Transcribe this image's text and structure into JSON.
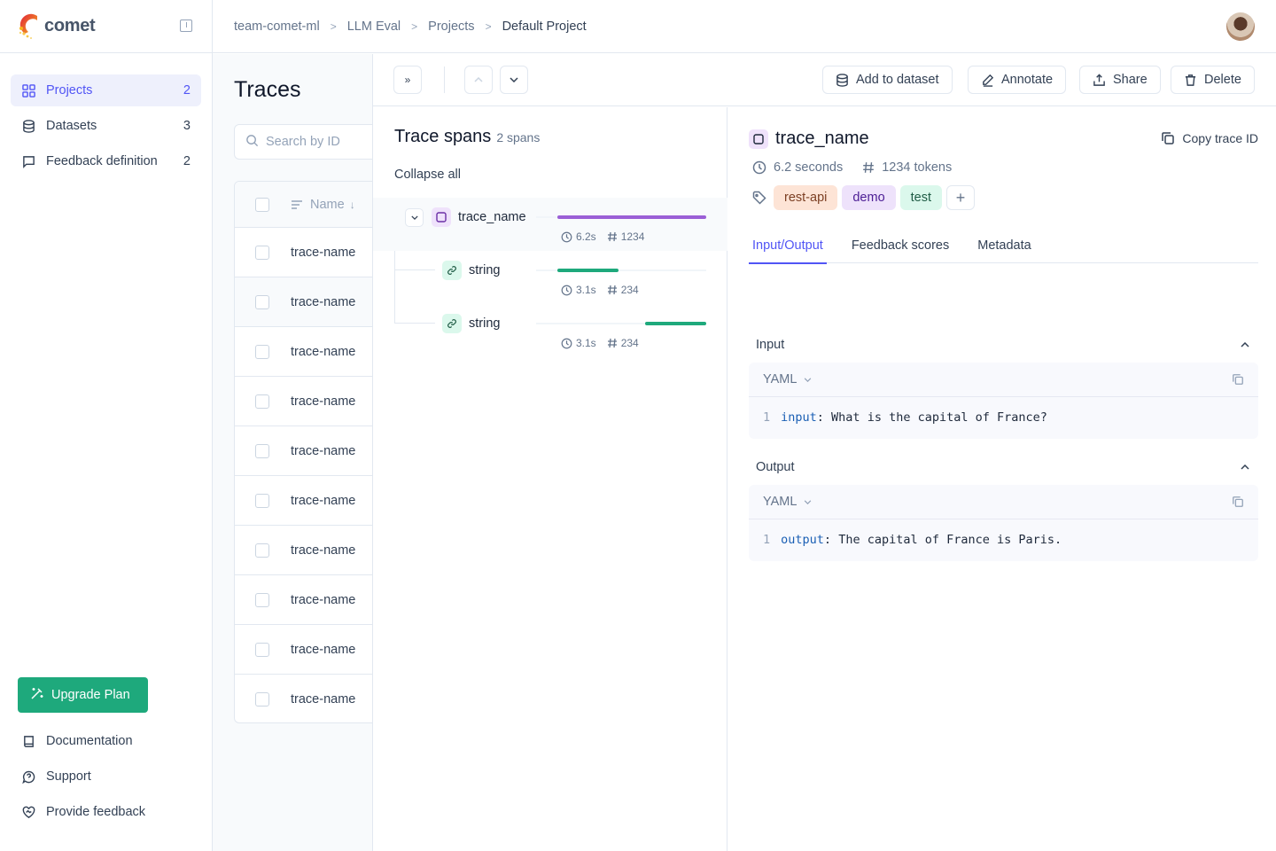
{
  "app": {
    "logo_text": "comet"
  },
  "sidebar": {
    "items": [
      {
        "label": "Projects",
        "count": "2",
        "icon": "grid-icon",
        "active": true
      },
      {
        "label": "Datasets",
        "count": "3",
        "icon": "database-icon"
      },
      {
        "label": "Feedback definition",
        "count": "2",
        "icon": "message-square-icon"
      }
    ],
    "upgrade_label": "Upgrade Plan",
    "bottom_items": [
      {
        "label": "Documentation",
        "icon": "book-icon"
      },
      {
        "label": "Support",
        "icon": "help-bubble-icon"
      },
      {
        "label": "Provide feedback",
        "icon": "heart-handshake-icon"
      }
    ]
  },
  "breadcrumb": [
    "team-comet-ml",
    "LLM Eval",
    "Projects",
    "Default Project"
  ],
  "traces": {
    "title": "Traces",
    "search_placeholder": "Search by ID",
    "column_name": "Name",
    "rows": [
      "trace-name",
      "trace-name",
      "trace-name",
      "trace-name",
      "trace-name",
      "trace-name",
      "trace-name",
      "trace-name",
      "trace-name",
      "trace-name"
    ]
  },
  "toolbar": {
    "add_to_dataset": "Add to dataset",
    "annotate": "Annotate",
    "share": "Share",
    "delete": "Delete"
  },
  "spans": {
    "title": "Trace spans",
    "count": "2 spans",
    "collapse_all": "Collapse all",
    "items": [
      {
        "name": "trace_name",
        "duration": "6.2s",
        "tokens": "1234",
        "type": "trace",
        "start": 0,
        "end": 1.0,
        "color": "#9b5fd6"
      },
      {
        "name": "string",
        "duration": "3.1s",
        "tokens": "234",
        "type": "llm",
        "start": 0,
        "end": 0.41,
        "color": "#1ea97c"
      },
      {
        "name": "string",
        "duration": "3.1s",
        "tokens": "234",
        "type": "llm",
        "start": 0.59,
        "end": 1.0,
        "color": "#1ea97c"
      }
    ]
  },
  "detail": {
    "name": "trace_name",
    "copy_label": "Copy trace ID",
    "duration": "6.2 seconds",
    "tokens": "1234 tokens",
    "tags": [
      {
        "label": "rest-api",
        "bg": "#fde4d6",
        "fg": "#7c3f23"
      },
      {
        "label": "demo",
        "bg": "#eee2fb",
        "fg": "#4c1d95"
      },
      {
        "label": "test",
        "bg": "#dbf8ec",
        "fg": "#1f5c45"
      }
    ],
    "tabs": [
      "Input/Output",
      "Feedback scores",
      "Metadata"
    ],
    "input": {
      "title": "Input",
      "format": "YAML",
      "line_no": "1",
      "key": "input",
      "value": " What is the capital of France?"
    },
    "output": {
      "title": "Output",
      "format": "YAML",
      "line_no": "1",
      "key": "output",
      "value": " The capital of France is Paris."
    }
  }
}
